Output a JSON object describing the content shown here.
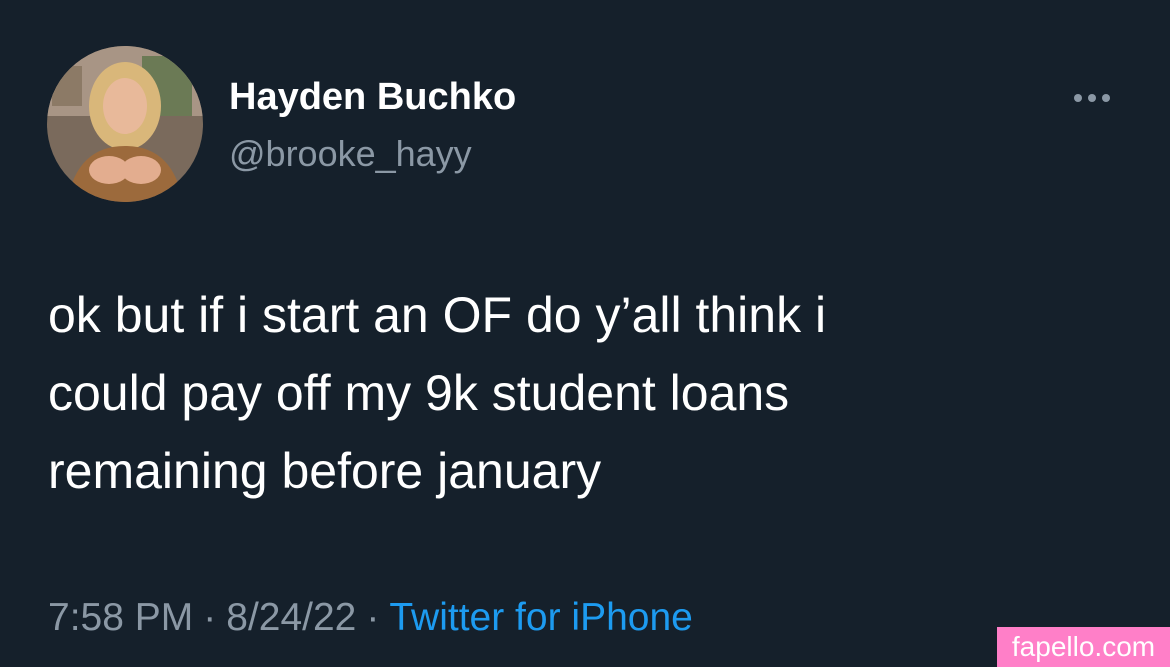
{
  "tweet": {
    "author": {
      "display_name": "Hayden Buchko",
      "handle": "@brooke_hayy",
      "avatar_icon": "profile-photo"
    },
    "more_icon": "ellipsis-icon",
    "text_lines": [
      "ok but if i start an OF do y’all think i",
      "could pay off my 9k student loans",
      "remaining before january"
    ],
    "time": "7:58 PM",
    "separator": "·",
    "date": "8/24/22",
    "source": "Twitter for iPhone"
  },
  "watermark": {
    "text": "fapello.com"
  },
  "colors": {
    "background": "#15202b",
    "primary_text": "#ffffff",
    "secondary_text": "#8b98a5",
    "link": "#1d9bf0",
    "watermark_bg": "#ff7fc8"
  }
}
